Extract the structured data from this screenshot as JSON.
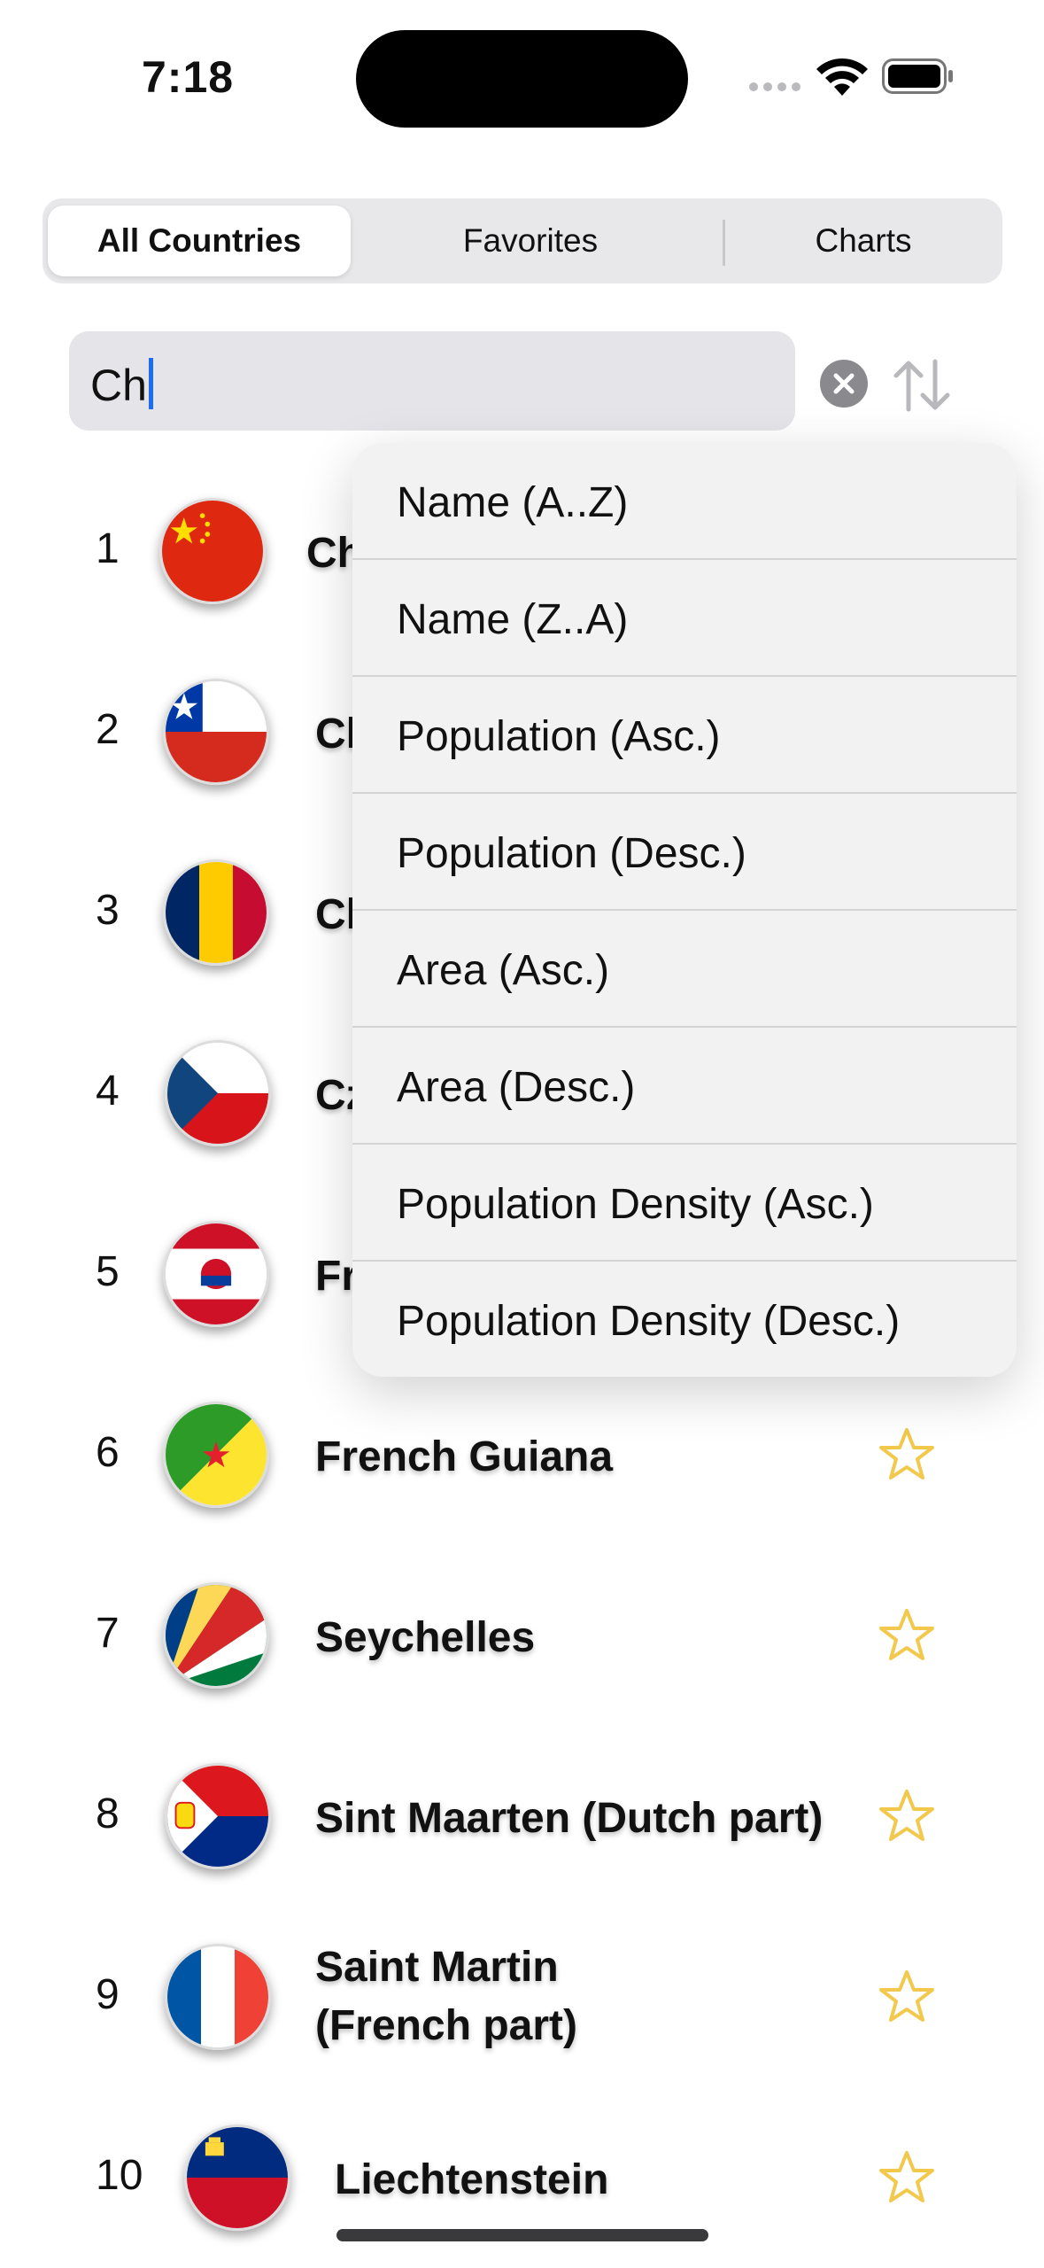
{
  "status_bar": {
    "time": "7:18"
  },
  "tabs": [
    {
      "label": "All Countries",
      "selected": true
    },
    {
      "label": "Favorites",
      "selected": false
    },
    {
      "label": "Charts",
      "selected": false
    }
  ],
  "search": {
    "value": "Ch",
    "clear_icon": "xmark-circle-icon",
    "sort_icon": "arrow-up-arrow-down-icon"
  },
  "countries": [
    {
      "rank": "1",
      "name": "Ch"
    },
    {
      "rank": "2",
      "name": "Cl"
    },
    {
      "rank": "3",
      "name": "Cl"
    },
    {
      "rank": "4",
      "name": "Cz"
    },
    {
      "rank": "5",
      "name": "Fr"
    },
    {
      "rank": "6",
      "name": "French Guiana"
    },
    {
      "rank": "7",
      "name": "Seychelles"
    },
    {
      "rank": "8",
      "name": "Sint Maarten (Dutch part)"
    },
    {
      "rank": "9",
      "name_line1": "Saint Martin",
      "name_line2": "(French part)"
    },
    {
      "rank": "10",
      "name": "Liechtenstein"
    }
  ],
  "sort_menu": [
    "Name (A..Z)",
    "Name (Z..A)",
    "Population (Asc.)",
    "Population (Desc.)",
    "Area (Asc.)",
    "Area (Desc.)",
    "Population Density (Asc.)",
    "Population Density (Desc.)"
  ],
  "colors": {
    "accent_star": "#f2c94c",
    "caret": "#1b6ef3"
  }
}
